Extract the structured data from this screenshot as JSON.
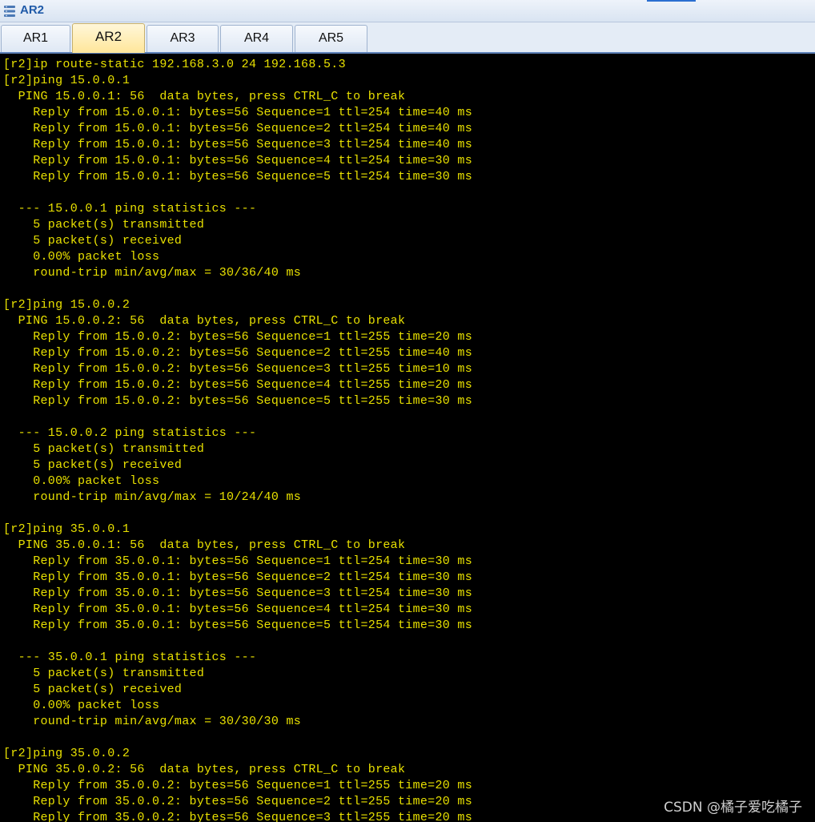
{
  "window": {
    "title": "AR2",
    "icon": "network-device-icon"
  },
  "tabs": [
    {
      "label": "AR1",
      "active": false
    },
    {
      "label": "AR2",
      "active": true
    },
    {
      "label": "AR3",
      "active": false
    },
    {
      "label": "AR4",
      "active": false
    },
    {
      "label": "AR5",
      "active": false
    }
  ],
  "terminal": {
    "text_color": "#e8e000",
    "background": "#000000",
    "lines": [
      "[r2]ip route-static 192.168.3.0 24 192.168.5.3",
      "[r2]ping 15.0.0.1",
      "  PING 15.0.0.1: 56  data bytes, press CTRL_C to break",
      "    Reply from 15.0.0.1: bytes=56 Sequence=1 ttl=254 time=40 ms",
      "    Reply from 15.0.0.1: bytes=56 Sequence=2 ttl=254 time=40 ms",
      "    Reply from 15.0.0.1: bytes=56 Sequence=3 ttl=254 time=40 ms",
      "    Reply from 15.0.0.1: bytes=56 Sequence=4 ttl=254 time=30 ms",
      "    Reply from 15.0.0.1: bytes=56 Sequence=5 ttl=254 time=30 ms",
      "",
      "  --- 15.0.0.1 ping statistics ---",
      "    5 packet(s) transmitted",
      "    5 packet(s) received",
      "    0.00% packet loss",
      "    round-trip min/avg/max = 30/36/40 ms",
      "",
      "[r2]ping 15.0.0.2",
      "  PING 15.0.0.2: 56  data bytes, press CTRL_C to break",
      "    Reply from 15.0.0.2: bytes=56 Sequence=1 ttl=255 time=20 ms",
      "    Reply from 15.0.0.2: bytes=56 Sequence=2 ttl=255 time=40 ms",
      "    Reply from 15.0.0.2: bytes=56 Sequence=3 ttl=255 time=10 ms",
      "    Reply from 15.0.0.2: bytes=56 Sequence=4 ttl=255 time=20 ms",
      "    Reply from 15.0.0.2: bytes=56 Sequence=5 ttl=255 time=30 ms",
      "",
      "  --- 15.0.0.2 ping statistics ---",
      "    5 packet(s) transmitted",
      "    5 packet(s) received",
      "    0.00% packet loss",
      "    round-trip min/avg/max = 10/24/40 ms",
      "",
      "[r2]ping 35.0.0.1",
      "  PING 35.0.0.1: 56  data bytes, press CTRL_C to break",
      "    Reply from 35.0.0.1: bytes=56 Sequence=1 ttl=254 time=30 ms",
      "    Reply from 35.0.0.1: bytes=56 Sequence=2 ttl=254 time=30 ms",
      "    Reply from 35.0.0.1: bytes=56 Sequence=3 ttl=254 time=30 ms",
      "    Reply from 35.0.0.1: bytes=56 Sequence=4 ttl=254 time=30 ms",
      "    Reply from 35.0.0.1: bytes=56 Sequence=5 ttl=254 time=30 ms",
      "",
      "  --- 35.0.0.1 ping statistics ---",
      "    5 packet(s) transmitted",
      "    5 packet(s) received",
      "    0.00% packet loss",
      "    round-trip min/avg/max = 30/30/30 ms",
      "",
      "[r2]ping 35.0.0.2",
      "  PING 35.0.0.2: 56  data bytes, press CTRL_C to break",
      "    Reply from 35.0.0.2: bytes=56 Sequence=1 ttl=255 time=20 ms",
      "    Reply from 35.0.0.2: bytes=56 Sequence=2 ttl=255 time=20 ms",
      "    Reply from 35.0.0.2: bytes=56 Sequence=3 ttl=255 time=20 ms"
    ]
  },
  "watermark": "CSDN @橘子爱吃橘子"
}
